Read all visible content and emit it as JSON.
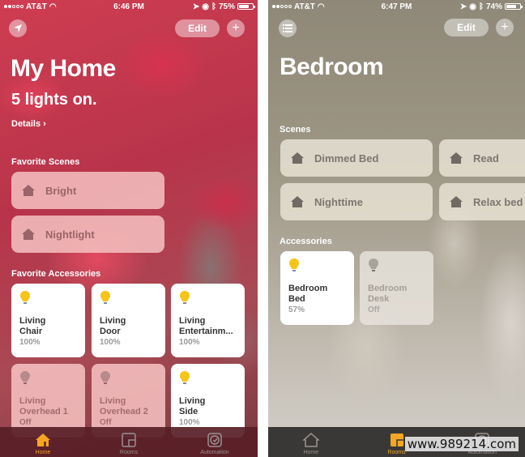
{
  "left_screen": {
    "status_bar": {
      "carrier": "AT&T",
      "time": "6:46 PM",
      "battery": "75%",
      "battery_level": 0.75
    },
    "edit_label": "Edit",
    "add_label": "+",
    "title": "My Home",
    "subtitle": "5 lights on.",
    "details_label": "Details ›",
    "favorite_scenes_label": "Favorite Scenes",
    "scenes": [
      {
        "name": "Bright"
      },
      {
        "name": "Nightlight"
      }
    ],
    "favorite_accessories_label": "Favorite Accessories",
    "accessories": [
      {
        "line1": "Living",
        "line2": "Chair",
        "value": "100%",
        "state": "on"
      },
      {
        "line1": "Living",
        "line2": "Door",
        "value": "100%",
        "state": "on"
      },
      {
        "line1": "Living",
        "line2": "Entertainm...",
        "value": "100%",
        "state": "on"
      },
      {
        "line1": "Living",
        "line2": "Overhead 1",
        "value": "Off",
        "state": "off"
      },
      {
        "line1": "Living",
        "line2": "Overhead 2",
        "value": "Off",
        "state": "off"
      },
      {
        "line1": "Living",
        "line2": "Side",
        "value": "100%",
        "state": "on"
      }
    ],
    "tabs": [
      {
        "label": "Home",
        "icon": "home-icon",
        "active": true
      },
      {
        "label": "Rooms",
        "icon": "rooms-icon",
        "active": false
      },
      {
        "label": "Automation",
        "icon": "automation-icon",
        "active": false
      }
    ]
  },
  "right_screen": {
    "status_bar": {
      "carrier": "AT&T",
      "time": "6:47 PM",
      "battery": "74%",
      "battery_level": 0.74
    },
    "edit_label": "Edit",
    "add_label": "+",
    "title": "Bedroom",
    "scenes_label": "Scenes",
    "scenes": [
      {
        "name": "Dimmed Bed"
      },
      {
        "name": "Read"
      },
      {
        "name": "Nighttime"
      },
      {
        "name": "Relax bed"
      }
    ],
    "accessories_label": "Accessories",
    "accessories": [
      {
        "line1": "Bedroom",
        "line2": "Bed",
        "value": "57%",
        "state": "on"
      },
      {
        "line1": "Bedroom",
        "line2": "Desk",
        "value": "Off",
        "state": "off"
      }
    ],
    "tabs": [
      {
        "label": "Home",
        "icon": "home-icon",
        "active": false
      },
      {
        "label": "Rooms",
        "icon": "rooms-icon",
        "active": true
      },
      {
        "label": "Automation",
        "icon": "automation-icon",
        "active": false
      }
    ]
  },
  "watermark": "www.989214.com",
  "colors": {
    "accent": "#f5a623",
    "bulb_on": "#f5c518",
    "bulb_off_left": "#b88a8c",
    "bulb_off_right": "#a8a49c"
  }
}
